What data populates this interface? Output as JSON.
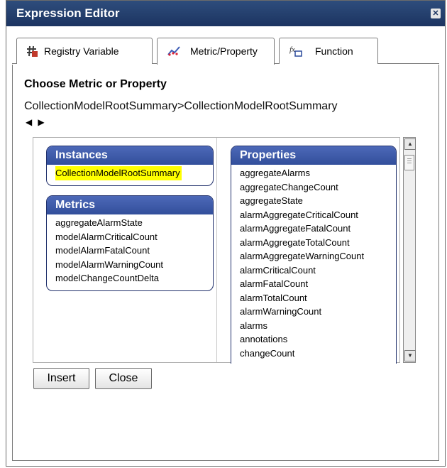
{
  "window": {
    "title": "Expression Editor",
    "close_glyph": "✕"
  },
  "tabs": [
    {
      "label": "Registry Variable",
      "icon": "registry-variable-icon",
      "active": false
    },
    {
      "label": "Metric/Property",
      "icon": "metric-property-icon",
      "active": true
    },
    {
      "label": "Function",
      "icon": "function-icon",
      "active": false
    }
  ],
  "content": {
    "heading": "Choose Metric or Property",
    "breadcrumb": "CollectionModelRootSummary>CollectionModelRootSummary",
    "nav": {
      "back": "◀",
      "forward": "▶"
    }
  },
  "instances": {
    "header": "Instances",
    "items": [
      "CollectionModelRootSummary"
    ],
    "selected_index": 0
  },
  "metrics": {
    "header": "Metrics",
    "items": [
      "aggregateAlarmState",
      "modelAlarmCriticalCount",
      "modelAlarmFatalCount",
      "modelAlarmWarningCount",
      "modelChangeCountDelta"
    ]
  },
  "properties": {
    "header": "Properties",
    "items": [
      "aggregateAlarms",
      "aggregateChangeCount",
      "aggregateState",
      "alarmAggregateCriticalCount",
      "alarmAggregateFatalCount",
      "alarmAggregateTotalCount",
      "alarmAggregateWarningCount",
      "alarmCriticalCount",
      "alarmFatalCount",
      "alarmTotalCount",
      "alarmWarningCount",
      "alarms",
      "annotations",
      "changeCount"
    ]
  },
  "buttons": {
    "insert": "Insert",
    "close": "Close"
  },
  "colors": {
    "titlebar": "#1c3461",
    "group_header": "#324f9b",
    "selection": "#ffff00"
  }
}
